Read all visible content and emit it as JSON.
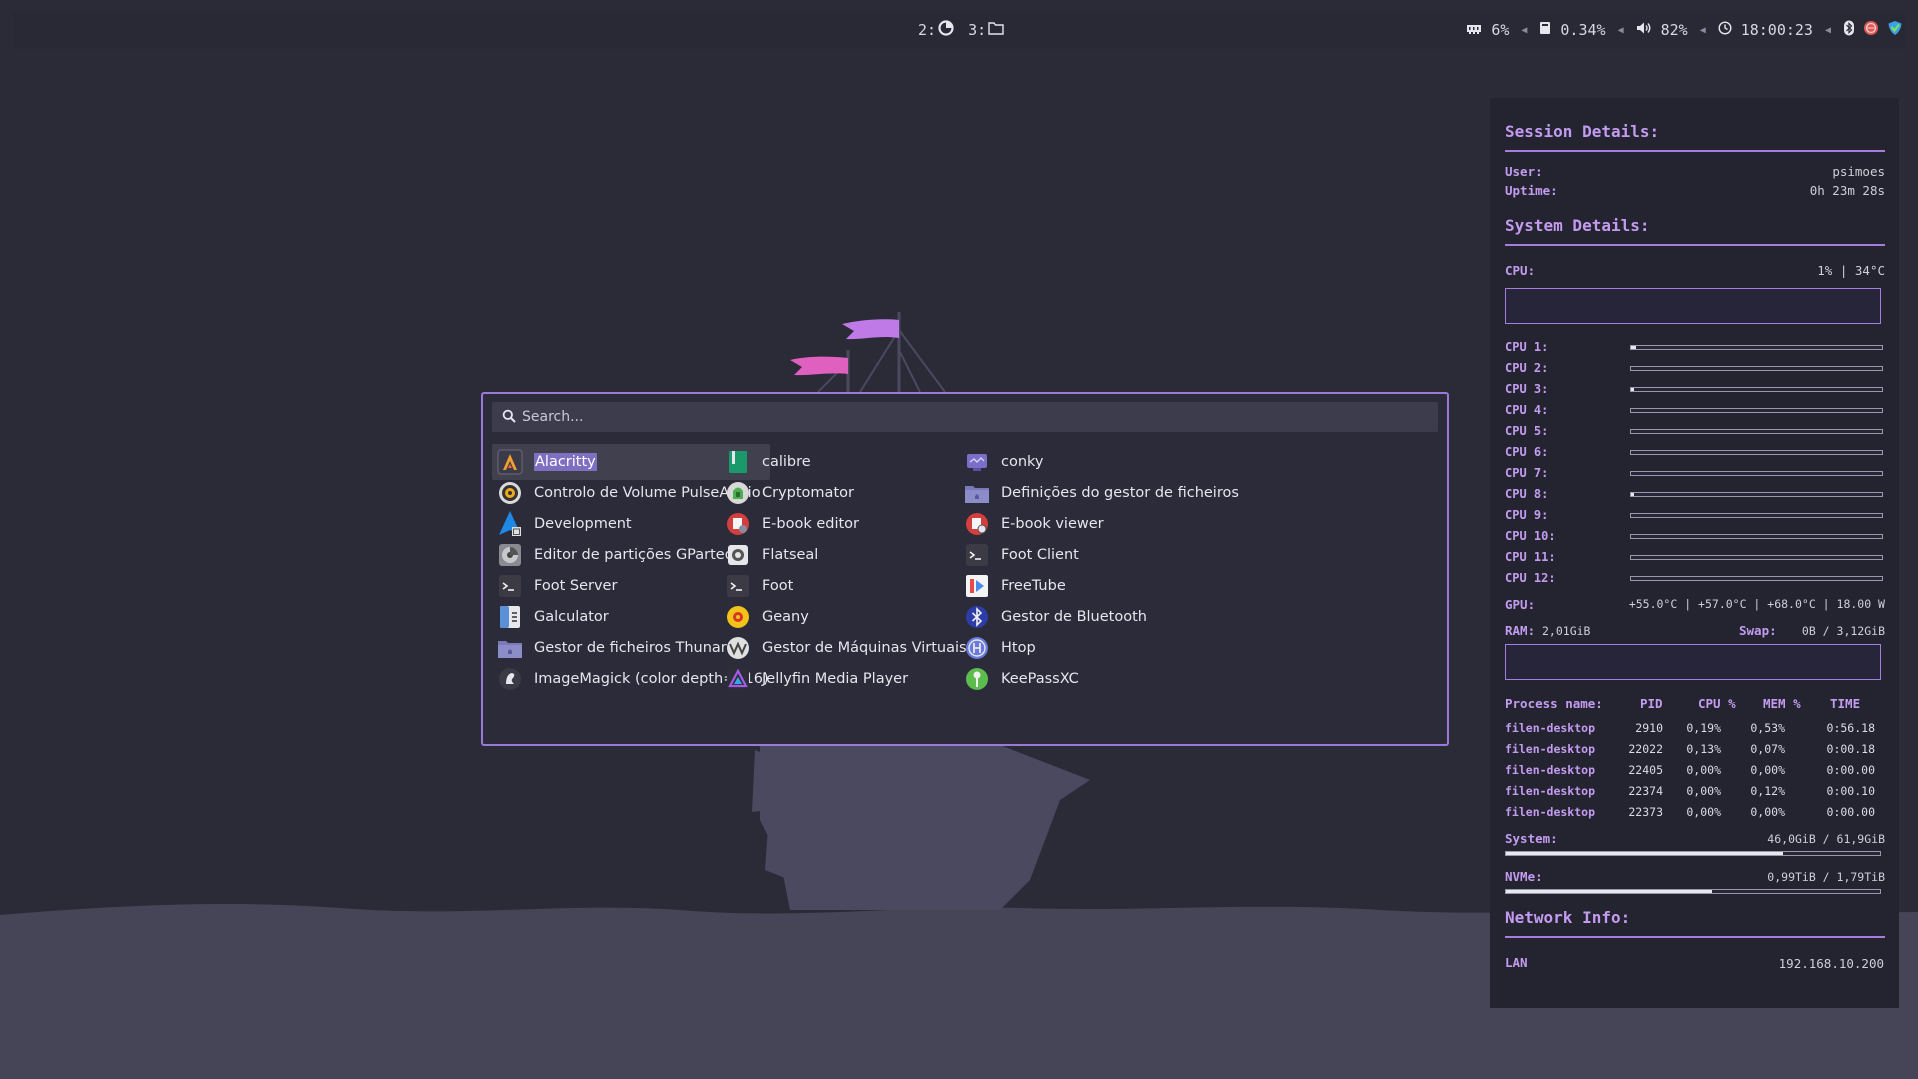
{
  "topbar": {
    "workspaces": [
      {
        "label": "2:",
        "icon": "firefox-icon"
      },
      {
        "label": "3:",
        "icon": "folder-icon"
      }
    ],
    "tray": {
      "memory": "6%",
      "disk": "0.34%",
      "volume": "82%",
      "clock": "18:00:23"
    }
  },
  "launcher": {
    "search_placeholder": "Search...",
    "apps": [
      {
        "name": "Alacritty",
        "icon": "alacritty-icon",
        "selected": true
      },
      {
        "name": "calibre",
        "icon": "calibre-icon"
      },
      {
        "name": "conky",
        "icon": "conky-icon"
      },
      {
        "name": "Controlo de Volume PulseAudio",
        "icon": "volume-control-icon"
      },
      {
        "name": "Cryptomator",
        "icon": "cryptomator-icon"
      },
      {
        "name": "Definições do gestor de ficheiros",
        "icon": "file-manager-settings-icon"
      },
      {
        "name": "Development",
        "icon": "development-icon"
      },
      {
        "name": "E-book editor",
        "icon": "ebook-editor-icon"
      },
      {
        "name": "E-book viewer",
        "icon": "ebook-viewer-icon"
      },
      {
        "name": "Editor de partições GParted",
        "icon": "gparted-icon"
      },
      {
        "name": "Flatseal",
        "icon": "flatseal-icon"
      },
      {
        "name": "Foot Client",
        "icon": "terminal-icon"
      },
      {
        "name": "Foot Server",
        "icon": "terminal-icon"
      },
      {
        "name": "Foot",
        "icon": "terminal-icon"
      },
      {
        "name": "FreeTube",
        "icon": "freetube-icon"
      },
      {
        "name": "Galculator",
        "icon": "calculator-icon"
      },
      {
        "name": "Geany",
        "icon": "geany-icon"
      },
      {
        "name": "Gestor de Bluetooth",
        "icon": "bluetooth-icon"
      },
      {
        "name": "Gestor de ficheiros Thunar",
        "icon": "thunar-icon"
      },
      {
        "name": "Gestor de Máquinas Virtuais",
        "icon": "virt-manager-icon"
      },
      {
        "name": "Htop",
        "icon": "htop-icon"
      },
      {
        "name": "ImageMagick (color depth=q16)",
        "icon": "imagemagick-icon"
      },
      {
        "name": "Jellyfin Media Player",
        "icon": "jellyfin-icon"
      },
      {
        "name": "KeePassXC",
        "icon": "keepassxc-icon"
      }
    ]
  },
  "conky": {
    "session_title": "Session Details:",
    "user_label": "User:",
    "user_value": "psimoes",
    "uptime_label": "Uptime:",
    "uptime_value": "0h 23m 28s",
    "system_title": "System Details:",
    "cpu_label": "CPU:",
    "cpu_value": "1% | 34°C",
    "cpus": [
      {
        "label": "CPU 1:",
        "usage": 0.02
      },
      {
        "label": "CPU 2:",
        "usage": 0
      },
      {
        "label": "CPU 3:",
        "usage": 0.01
      },
      {
        "label": "CPU 4:",
        "usage": 0
      },
      {
        "label": "CPU 5:",
        "usage": 0
      },
      {
        "label": "CPU 6:",
        "usage": 0
      },
      {
        "label": "CPU 7:",
        "usage": 0
      },
      {
        "label": "CPU 8:",
        "usage": 0.01
      },
      {
        "label": "CPU 9:",
        "usage": 0
      },
      {
        "label": "CPU 10:",
        "usage": 0
      },
      {
        "label": "CPU 11:",
        "usage": 0
      },
      {
        "label": "CPU 12:",
        "usage": 0
      }
    ],
    "gpu_label": "GPU:",
    "gpu_value": "+55.0°C | +57.0°C | +68.0°C | 18.00 W",
    "ram_label": "RAM:",
    "ram_value": "2,01GiB",
    "swap_label": "Swap:",
    "swap_value": "0B / 3,12GiB",
    "proc_headers": {
      "name": "Process name:",
      "pid": "PID",
      "cpu": "CPU %",
      "mem": "MEM %",
      "time": "TIME"
    },
    "processes": [
      {
        "name": "filen-desktop",
        "pid": "2910",
        "cpu": "0,19%",
        "mem": "0,53%",
        "time": "0:56.18"
      },
      {
        "name": "filen-desktop",
        "pid": "22022",
        "cpu": "0,13%",
        "mem": "0,07%",
        "time": "0:00.18"
      },
      {
        "name": "filen-desktop",
        "pid": "22405",
        "cpu": "0,00%",
        "mem": "0,00%",
        "time": "0:00.00"
      },
      {
        "name": "filen-desktop",
        "pid": "22374",
        "cpu": "0,00%",
        "mem": "0,12%",
        "time": "0:00.10"
      },
      {
        "name": "filen-desktop",
        "pid": "22373",
        "cpu": "0,00%",
        "mem": "0,00%",
        "time": "0:00.00"
      }
    ],
    "system_disk_label": "System:",
    "system_disk_value": "46,0GiB / 61,9GiB",
    "system_disk_usage": 0.74,
    "nvme_label": "NVMe:",
    "nvme_value": "0,99TiB / 1,79TiB",
    "nvme_usage": 0.55,
    "network_title": "Network Info:",
    "lan_label": "LAN",
    "lan_value": "192.168.10.200"
  },
  "colors": {
    "background": "#2b2a37",
    "accent": "#a57ce0",
    "selection": "#7f6fc0",
    "flag_pink": "#e060c0",
    "flag_violet": "#c07ae8",
    "sea": "#464558"
  }
}
